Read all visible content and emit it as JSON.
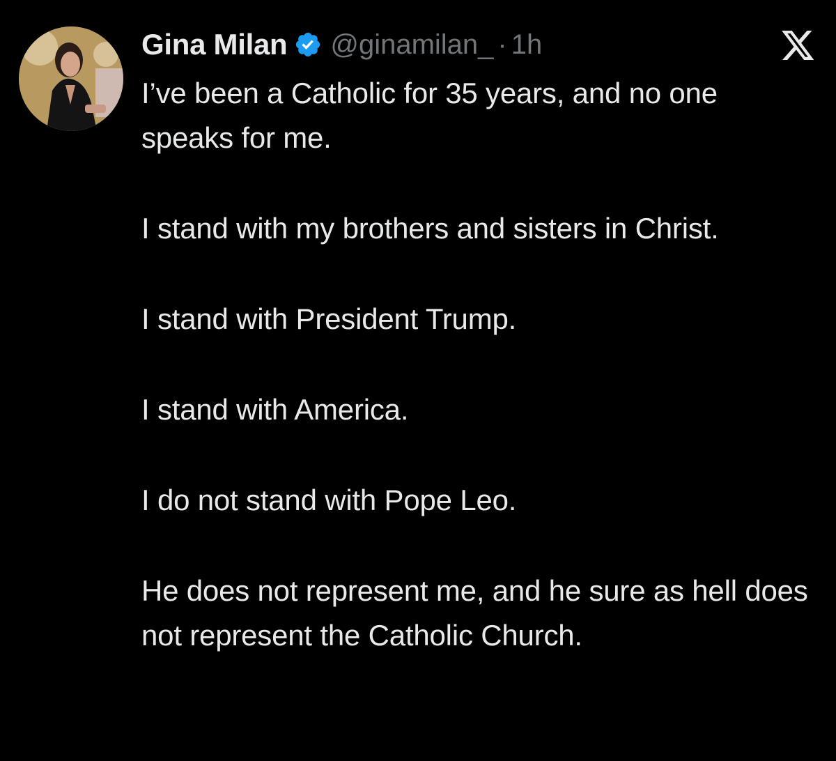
{
  "post": {
    "author": {
      "display_name": "Gina Milan",
      "handle": "@ginamilan_",
      "verified": true,
      "verified_color": "#1d9bf0",
      "avatar": "profile-photo"
    },
    "separator": "·",
    "time": "1h",
    "brand_icon": "x-logo-icon",
    "paragraphs": [
      "I’ve been a Catholic for 35 years, and no one speaks for me.",
      "I stand with my brothers and sisters in Christ.",
      "I stand with President Trump.",
      "I stand with America.",
      "I do not stand with Pope Leo.",
      "He does not represent me, and he sure as hell does not represent the Catholic Church."
    ]
  },
  "theme": {
    "background": "#000000",
    "text": "#e7e9ea",
    "muted": "#71767b"
  }
}
